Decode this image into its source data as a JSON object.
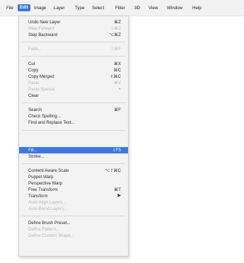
{
  "menubar": {
    "items": [
      "File",
      "Edit",
      "Image",
      "Layer",
      "Type",
      "Select",
      "Filter",
      "3D",
      "View",
      "Window",
      "Help"
    ],
    "active": "Edit"
  },
  "edit_menu": {
    "items": [
      {
        "label": "Undo New Layer",
        "shortcut": "⌘Z",
        "enabled": true
      },
      {
        "label": "Step Forward",
        "shortcut": "⇧⌘Z",
        "enabled": false
      },
      {
        "label": "Step Backward",
        "shortcut": "⌥⌘Z",
        "enabled": true
      },
      {
        "label": "Fade...",
        "shortcut": "⇧⌘F",
        "enabled": false
      },
      {
        "label": "Cut",
        "shortcut": "⌘X",
        "enabled": true
      },
      {
        "label": "Copy",
        "shortcut": "⌘C",
        "enabled": true
      },
      {
        "label": "Copy Merged",
        "shortcut": "⇧⌘C",
        "enabled": true
      },
      {
        "label": "Paste",
        "shortcut": "⌘V",
        "enabled": false
      },
      {
        "label": "Paste Special",
        "shortcut": "▸",
        "enabled": false
      },
      {
        "label": "Clear",
        "shortcut": "",
        "enabled": true
      },
      {
        "label": "Search",
        "shortcut": "⌘F",
        "enabled": true
      },
      {
        "label": "Check Spelling...",
        "shortcut": "",
        "enabled": true
      },
      {
        "label": "Find and Replace Text...",
        "shortcut": "",
        "enabled": true
      },
      {
        "label": "Fill...",
        "shortcut": "⇧F5",
        "enabled": true,
        "highlighted": true
      },
      {
        "label": "Stroke...",
        "shortcut": "",
        "enabled": true
      },
      {
        "label": "Content-Aware Scale",
        "shortcut": "⌥⇧⌘C",
        "enabled": true
      },
      {
        "label": "Puppet Warp",
        "shortcut": "",
        "enabled": true
      },
      {
        "label": "Perspective Warp",
        "shortcut": "",
        "enabled": true
      },
      {
        "label": "Free Transform",
        "shortcut": "⌘T",
        "enabled": true
      },
      {
        "label": "Transform",
        "shortcut": "▶",
        "enabled": true
      },
      {
        "label": "Auto-Align Layers...",
        "shortcut": "",
        "enabled": false
      },
      {
        "label": "Auto-Blend Layers...",
        "shortcut": "",
        "enabled": false
      },
      {
        "label": "Define Brush Preset...",
        "shortcut": "",
        "enabled": true
      },
      {
        "label": "Define Pattern...",
        "shortcut": "",
        "enabled": false
      },
      {
        "label": "Define Custom Shape...",
        "shortcut": "",
        "enabled": false
      }
    ]
  },
  "colors": {
    "highlight": "#3a78e6",
    "menu_bg": "#f3f3f3",
    "disabled_text": "#b7b7b7"
  }
}
